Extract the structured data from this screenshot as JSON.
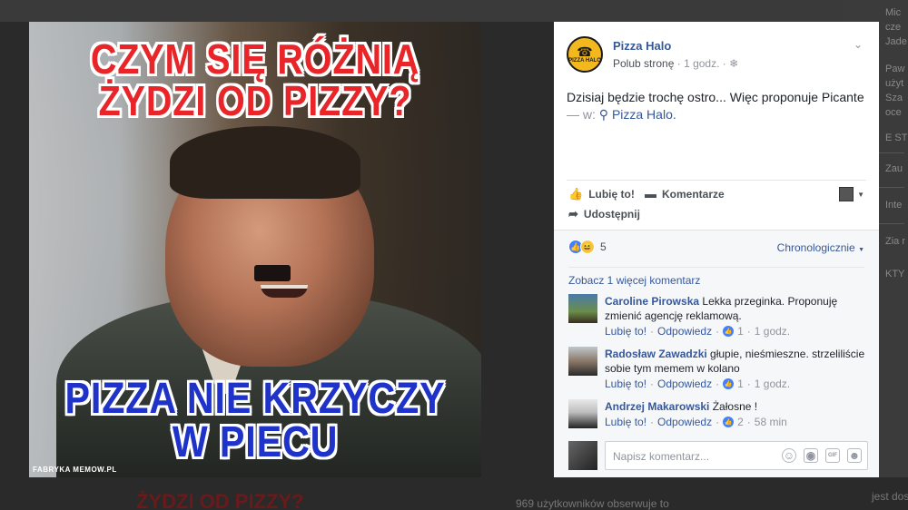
{
  "photo": {
    "top_text": "CZYM SIĘ RÓŻNIĄ ŻYDZI OD PIZZY?",
    "bottom_text": "PIZZA NIE KRZYCZY W PIECU",
    "watermark": "FABRYKA MEMOW.PL",
    "bg_url_fragment": "WWW.PIZZAHALO.PL"
  },
  "post": {
    "page_name": "Pizza Halo",
    "logo_text": "PIZZA HALO",
    "like_page": "Polub stronę",
    "time": "1 godz.",
    "text": "Dzisiaj będzie trochę ostro... Więc proponuje Picante",
    "location_prefix": "— w:",
    "location": "Pizza Halo."
  },
  "actions": {
    "like": "Lubię to!",
    "comment": "Komentarze",
    "share": "Udostępnij"
  },
  "reactions": {
    "count": "5",
    "order": "Chronologicznie"
  },
  "comments_header": {
    "more": "Zobacz 1 więcej komentarz"
  },
  "comments": [
    {
      "author": "Caroline Pirowska",
      "text": "Lekka przeginka. Proponuję zmienić agencję reklamową.",
      "like": "Lubię to!",
      "reply": "Odpowiedz",
      "likes": "1",
      "time": "1 godz."
    },
    {
      "author": "Radosław Zawadzki",
      "text": "głupie, nieśmieszne. strzeliliście sobie tym memem w kolano",
      "like": "Lubię to!",
      "reply": "Odpowiedz",
      "likes": "1",
      "time": "1 godz."
    },
    {
      "author": "Andrzej Makarowski",
      "text": "Żałosne !",
      "like": "Lubię to!",
      "reply": "Odpowiedz",
      "likes": "2",
      "time": "58 min"
    }
  ],
  "compose": {
    "placeholder": "Napisz komentarz..."
  },
  "background": {
    "right_texts": [
      "Mic",
      "cze",
      "Jade",
      "Paw",
      "użyt",
      "Sza",
      "oce",
      "E STR",
      "Zau",
      "Inte",
      "Zia r",
      "KTY"
    ],
    "bottom_texts": [
      "969 użytkowników obserwuje to",
      "ŻYDZI OD PIZZY?",
      "jest dost"
    ]
  },
  "colors": {
    "link": "#365899",
    "meme_red": "#e8262a",
    "meme_blue": "#1f33c9",
    "like_blue": "#4080ff",
    "logo_yellow": "#f4b81f"
  }
}
